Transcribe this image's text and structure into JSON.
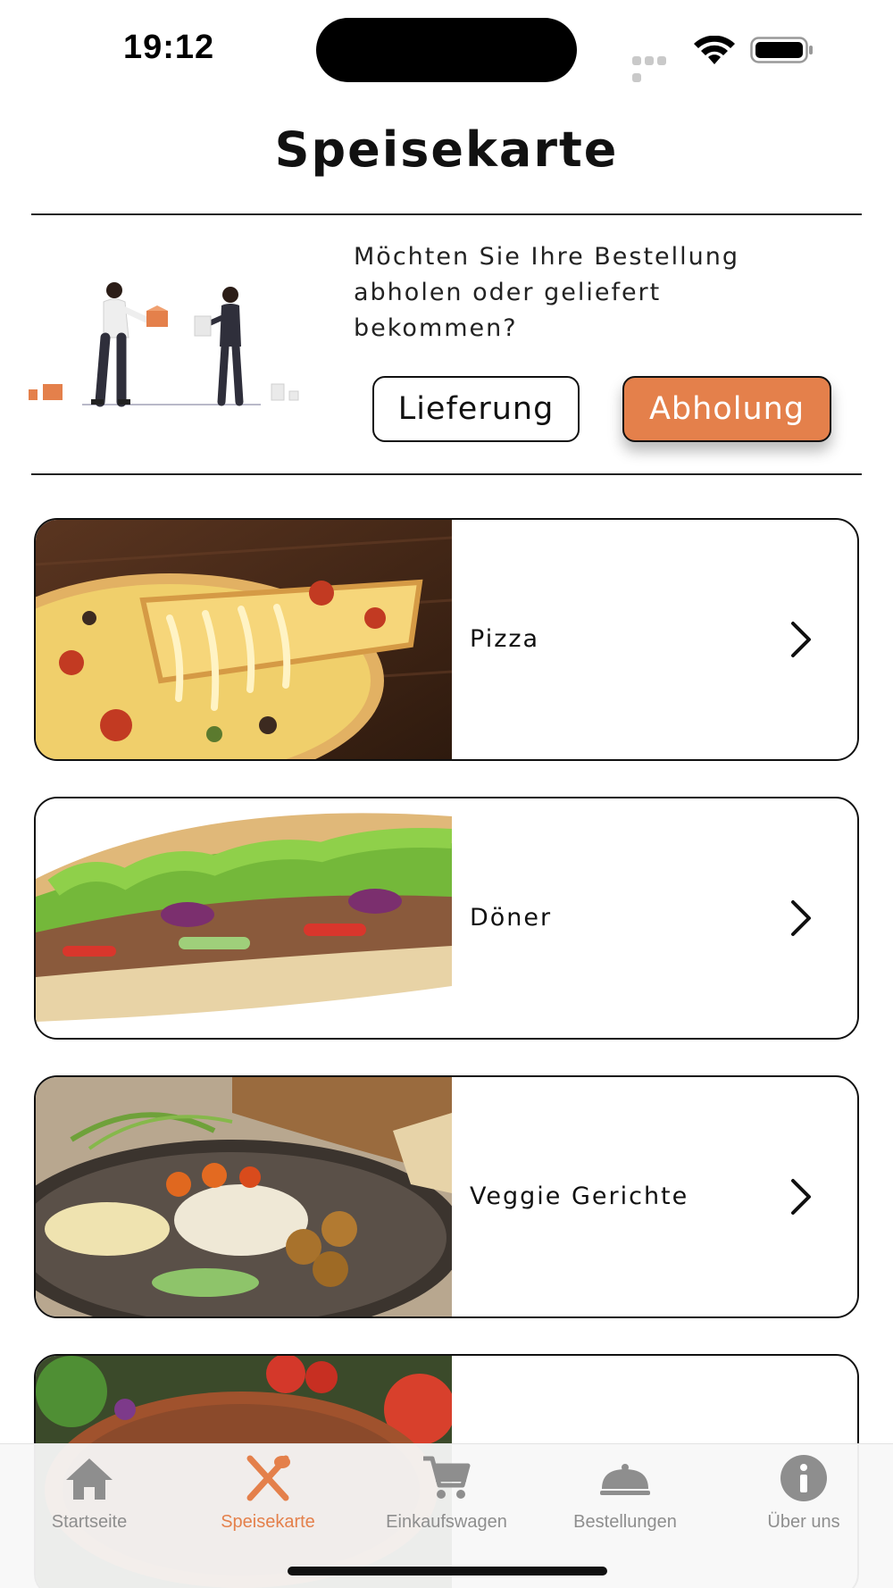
{
  "status_bar": {
    "time": "19:12"
  },
  "header": {
    "title": "Speisekarte"
  },
  "delivery": {
    "question": "Möchten Sie Ihre Bestellung abholen oder geliefert bekommen?",
    "options": [
      {
        "label": "Lieferung",
        "selected": false
      },
      {
        "label": "Abholung",
        "selected": true
      }
    ]
  },
  "categories": [
    {
      "label": "Pizza",
      "image": "pizza-photo"
    },
    {
      "label": "Döner",
      "image": "doner-photo"
    },
    {
      "label": "Veggie Gerichte",
      "image": "veggie-photo"
    },
    {
      "label": "",
      "image": "lahmacun-photo"
    }
  ],
  "tab_bar": {
    "items": [
      {
        "label": "Startseite",
        "icon": "home-icon",
        "active": false
      },
      {
        "label": "Speisekarte",
        "icon": "fork-knife-icon",
        "active": true
      },
      {
        "label": "Einkaufswagen",
        "icon": "cart-icon",
        "active": false
      },
      {
        "label": "Bestellungen",
        "icon": "cloche-icon",
        "active": false
      },
      {
        "label": "Über uns",
        "icon": "info-icon",
        "active": false
      }
    ]
  },
  "colors": {
    "accent": "#e4804b",
    "inactive_tab": "#8e8e8e",
    "text": "#111111"
  }
}
